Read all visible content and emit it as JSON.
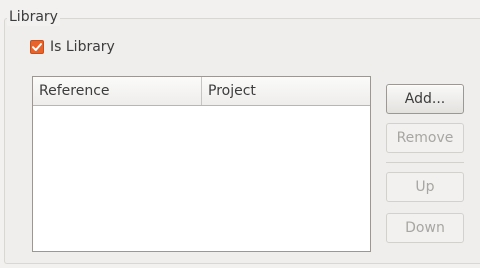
{
  "group": {
    "title": "Library"
  },
  "is_library": {
    "label": "Is Library",
    "checked": true,
    "check_color": "#e8622b"
  },
  "table": {
    "columns": [
      "Reference",
      "Project"
    ],
    "rows": []
  },
  "buttons": {
    "add": "Add...",
    "remove": "Remove",
    "up": "Up",
    "down": "Down"
  }
}
